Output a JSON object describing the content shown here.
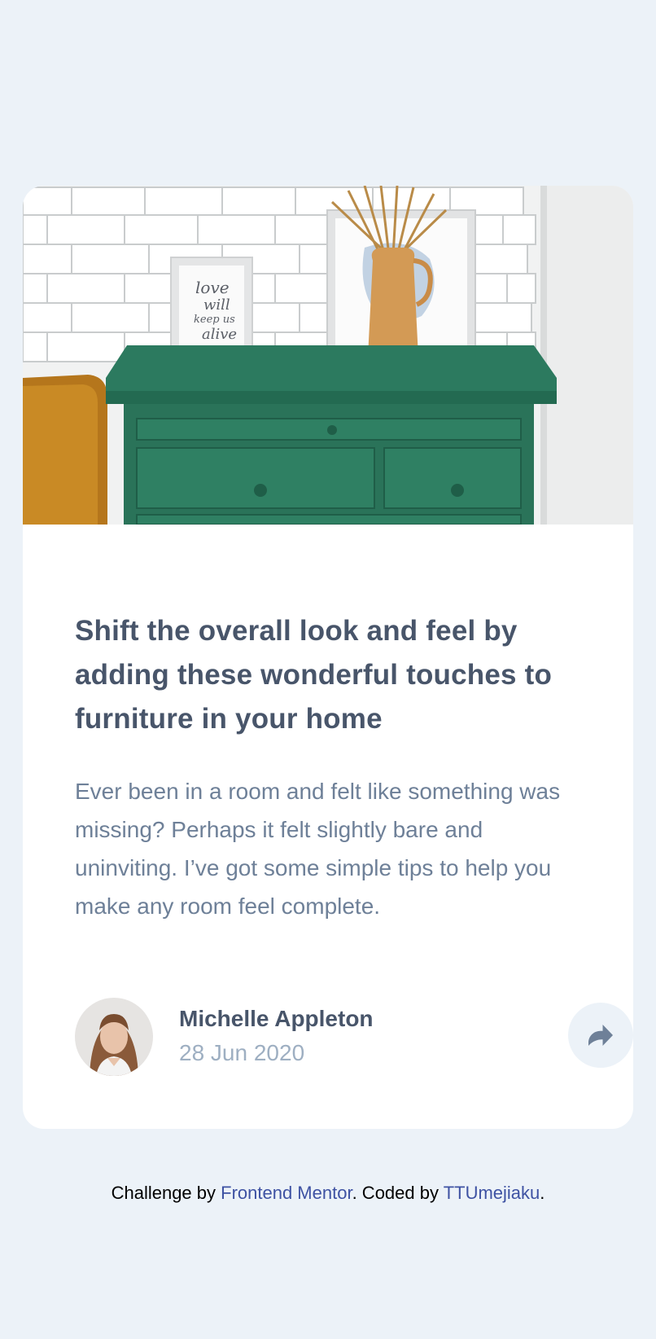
{
  "article": {
    "headline": "Shift the overall look and feel by adding these wonderful touches to furniture in your home",
    "excerpt": "Ever been in a room and felt like something was missing? Perhaps it felt slightly bare and uninviting. I’ve got some simple tips to help you make any room feel complete.",
    "hero_image": {
      "frame_text": [
        "love",
        "will",
        "keep us",
        "alive"
      ]
    }
  },
  "author": {
    "name": "Michelle Appleton",
    "date": "28 Jun 2020"
  },
  "share": {
    "icon": "share-arrow-icon"
  },
  "footer": {
    "prefix": "Challenge by ",
    "link1": "Frontend Mentor",
    "middle": ". Coded by ",
    "link2": "TTUmejiaku",
    "suffix": "."
  },
  "colors": {
    "background": "#ecf2f8",
    "card": "#ffffff",
    "headline": "#48556a",
    "body": "#6e8098",
    "date": "#9eafc2",
    "link": "#3e52a3",
    "dresser": "#2c7a5f"
  }
}
